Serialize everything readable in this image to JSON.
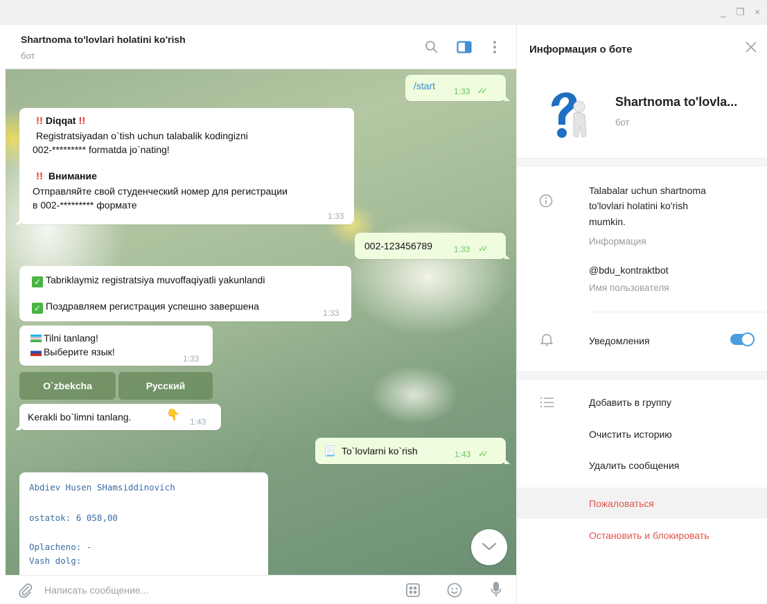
{
  "window": {
    "minimize": "_",
    "restore": "❐",
    "close": "×"
  },
  "chat": {
    "title": "Shartnoma to'lovlari holatini ko'rish",
    "subtitle": "бот",
    "icons": [
      "search-icon",
      "sidebar-toggle-icon",
      "more-vertical-icon"
    ]
  },
  "messages": {
    "start": {
      "text": "/start",
      "time": "1:33",
      "ticks": "✓✓"
    },
    "warn": {
      "excl": "!!",
      "title_uz": "Diqqat",
      "body_uz_1": "Registratsiyadan o`tish uchun talabalik kodingizni",
      "body_uz_2": "002-********* formatda jo`nating!",
      "title_ru": "Внимание",
      "body_ru_1": "Отправляйте свой студенческий номер для регистрации",
      "body_ru_2": "в 002-********* формате",
      "time": "1:33"
    },
    "code": {
      "text": "002-123456789",
      "time": "1:33",
      "ticks": "✓✓"
    },
    "success": {
      "check": "✓",
      "line_uz": "Tabriklaymiz registratsiya muvoffaqiyatli yakunlandi",
      "line_ru": "Поздравляем регистрация успешно завершена",
      "time": "1:33"
    },
    "lang": {
      "line_uz": "Tilni tanlang!",
      "line_ru": "Выберите язык!",
      "time": "1:33"
    },
    "keyboard": {
      "uz": "O`zbekcha",
      "ru": "Русский"
    },
    "section": {
      "text": "Kerakli bo`limni tanlang.",
      "emoji": "👇",
      "time": "1:43"
    },
    "payments": {
      "emoji": "📃",
      "text": "To`lovlarni ko`rish",
      "time": "1:43",
      "ticks": "✓✓"
    },
    "result": {
      "name": "Abdiev Husen SHamsiddinovich",
      "ostatok": "ostatok:  6 058,00",
      "oplacheno": "Oplacheno:  -",
      "dolg": "Vash dolg:"
    }
  },
  "composer": {
    "placeholder": "Написать сообщение..."
  },
  "panel": {
    "title": "Информация о боте",
    "bot_name": "Shartnoma to'lovla...",
    "bot_sub": "бот",
    "description_1": "Talabalar uchun shartnoma",
    "description_2": "to'lovlari holatini ko'rish",
    "description_3": "mumkin.",
    "description_label": "Информация",
    "username": "@bdu_kontraktbot",
    "username_label": "Имя пользователя",
    "notifications": "Уведомления",
    "notifications_on": true,
    "actions": {
      "add_group": "Добавить в группу",
      "clear_history": "Очистить историю",
      "delete_messages": "Удалить сообщения",
      "report": "Пожаловаться",
      "block": "Остановить и блокировать"
    }
  },
  "colors": {
    "accent": "#4a9ee0",
    "outgoing": "#effdde",
    "danger": "#e0544f",
    "check": "#4bb543"
  }
}
